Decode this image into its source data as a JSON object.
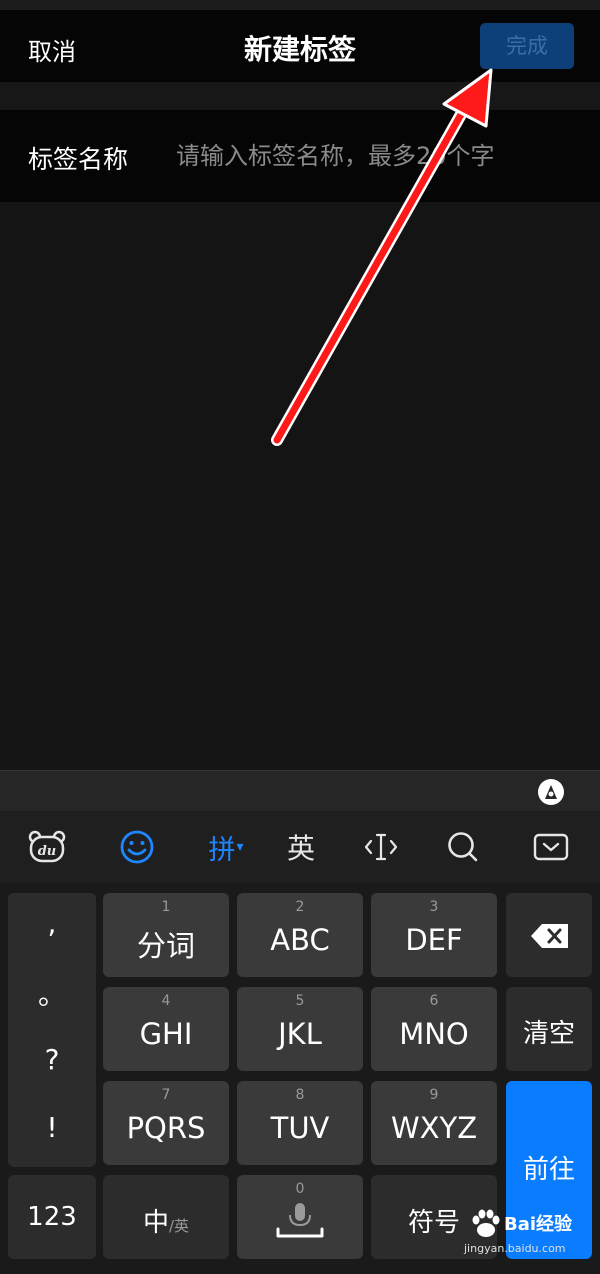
{
  "navbar": {
    "cancel_label": "取消",
    "title": "新建标签",
    "done_label": "完成"
  },
  "form": {
    "name_label": "标签名称",
    "name_placeholder": "请输入标签名称，最多20个字",
    "name_value": ""
  },
  "keyboard": {
    "toolbar": [
      {
        "name": "baidu-logo-icon",
        "glyph": "du"
      },
      {
        "name": "emoji-icon",
        "glyph": "☺"
      },
      {
        "name": "pinyin-mode",
        "glyph": "拼▾"
      },
      {
        "name": "english-mode",
        "glyph": "英"
      },
      {
        "name": "cursor-icon",
        "glyph": "‹I›"
      },
      {
        "name": "search-icon",
        "glyph": "○"
      },
      {
        "name": "hide-keyboard-icon",
        "glyph": "⌄"
      }
    ],
    "punctuation": [
      ",",
      "。",
      "?",
      "!"
    ],
    "keys": [
      {
        "num": "1",
        "label": "分词"
      },
      {
        "num": "2",
        "label": "ABC"
      },
      {
        "num": "3",
        "label": "DEF"
      },
      {
        "num": "4",
        "label": "GHI"
      },
      {
        "num": "5",
        "label": "JKL"
      },
      {
        "num": "6",
        "label": "MNO"
      },
      {
        "num": "7",
        "label": "PQRS"
      },
      {
        "num": "8",
        "label": "TUV"
      },
      {
        "num": "9",
        "label": "WXYZ"
      }
    ],
    "clear_label": "清空",
    "go_label": "前往",
    "num_label": "123",
    "lang_main": "中",
    "lang_sub": "/英",
    "space_num": "0",
    "symbol_label": "符号"
  },
  "watermark": {
    "brand": "Bai经验",
    "url": "jingyan.baidu.com"
  },
  "colors": {
    "accent": "#0a7cff",
    "done_button_bg": "#0d3f78",
    "arrow": "#ff1a1a"
  }
}
